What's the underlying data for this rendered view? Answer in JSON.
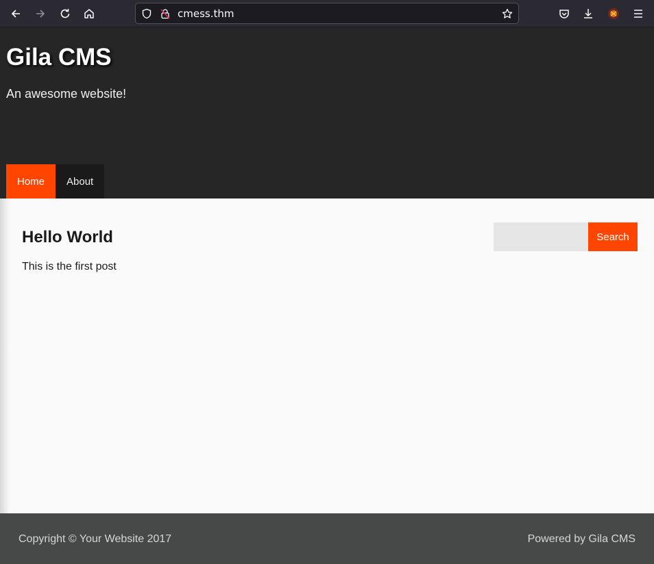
{
  "browser": {
    "url": "cmess.thm",
    "icons": [
      "back-icon",
      "forward-icon",
      "reload-icon",
      "home-icon",
      "shield-icon",
      "lock-icon",
      "bookmark-star-icon",
      "pocket-icon",
      "download-icon",
      "extension-icon",
      "menu-icon"
    ]
  },
  "site": {
    "title": "Gila CMS",
    "tagline": "An awesome website!"
  },
  "nav": {
    "items": [
      {
        "label": "Home",
        "active": true
      },
      {
        "label": "About",
        "active": false
      }
    ]
  },
  "post": {
    "title": "Hello World",
    "body": "This is the first post"
  },
  "search": {
    "value": "",
    "button_label": "Search"
  },
  "footer": {
    "copyright": "Copyright © Your Website 2017",
    "powered": "Powered by Gila CMS"
  },
  "colors": {
    "accent": "#ff4500",
    "header_bg": "#262626",
    "footer_bg": "#464948",
    "chrome_bg": "#2b2a33"
  }
}
